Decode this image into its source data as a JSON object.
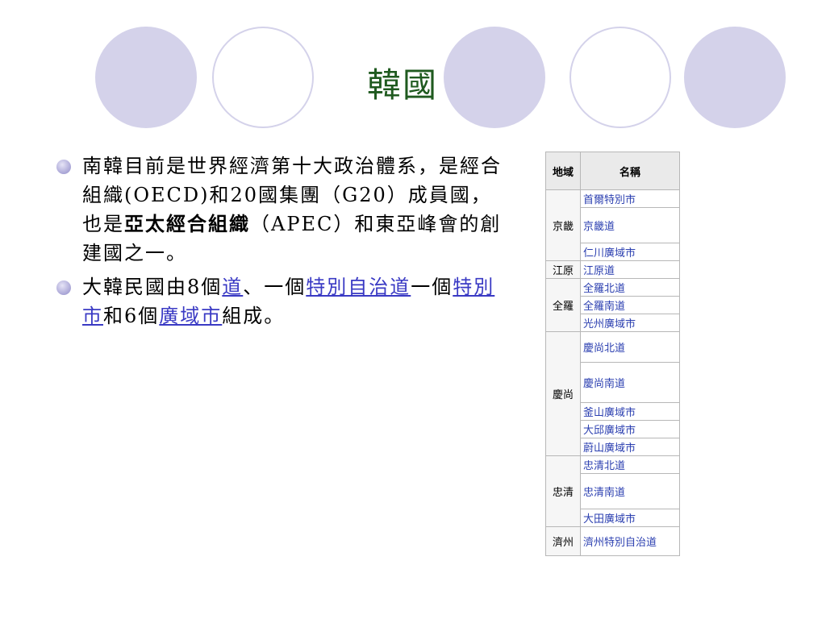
{
  "slide": {
    "title": "韓國",
    "accent_color": "#d4d2ea",
    "bullet1": {
      "text_a": "南韓目前是世界經濟第十大政治體系，是經合組織(OECD)和20國集團（G20）成員國，也是",
      "bold": "亞太經合組織",
      "text_b": "（APEC）和東亞峰會的創建國之一。"
    },
    "bullet2": {
      "text_a": "大韓民國由8個",
      "link1": "道",
      "text_b": "、一個",
      "link2": "特別自治道",
      "text_c": "一個",
      "link3": "特別市",
      "text_d": "和6個",
      "link4": "廣域市",
      "text_e": "組成。"
    }
  },
  "table": {
    "header_region": "地域",
    "header_name": "名稱",
    "groups": [
      {
        "region": "京畿",
        "names": [
          "首爾特別市",
          "京畿道",
          "仁川廣域市"
        ]
      },
      {
        "region": "江原",
        "names": [
          "江原道"
        ]
      },
      {
        "region": "全羅",
        "names": [
          "全羅北道",
          "全羅南道",
          "光州廣域市"
        ]
      },
      {
        "region": "慶尚",
        "names": [
          "慶尚北道",
          "慶尚南道",
          "釜山廣域市",
          "大邱廣域市",
          "蔚山廣域市"
        ]
      },
      {
        "region": "忠清",
        "names": [
          "忠清北道",
          "忠清南道",
          "大田廣域市"
        ]
      },
      {
        "region": "濟州",
        "names": [
          "濟州特別自治道"
        ]
      }
    ]
  }
}
